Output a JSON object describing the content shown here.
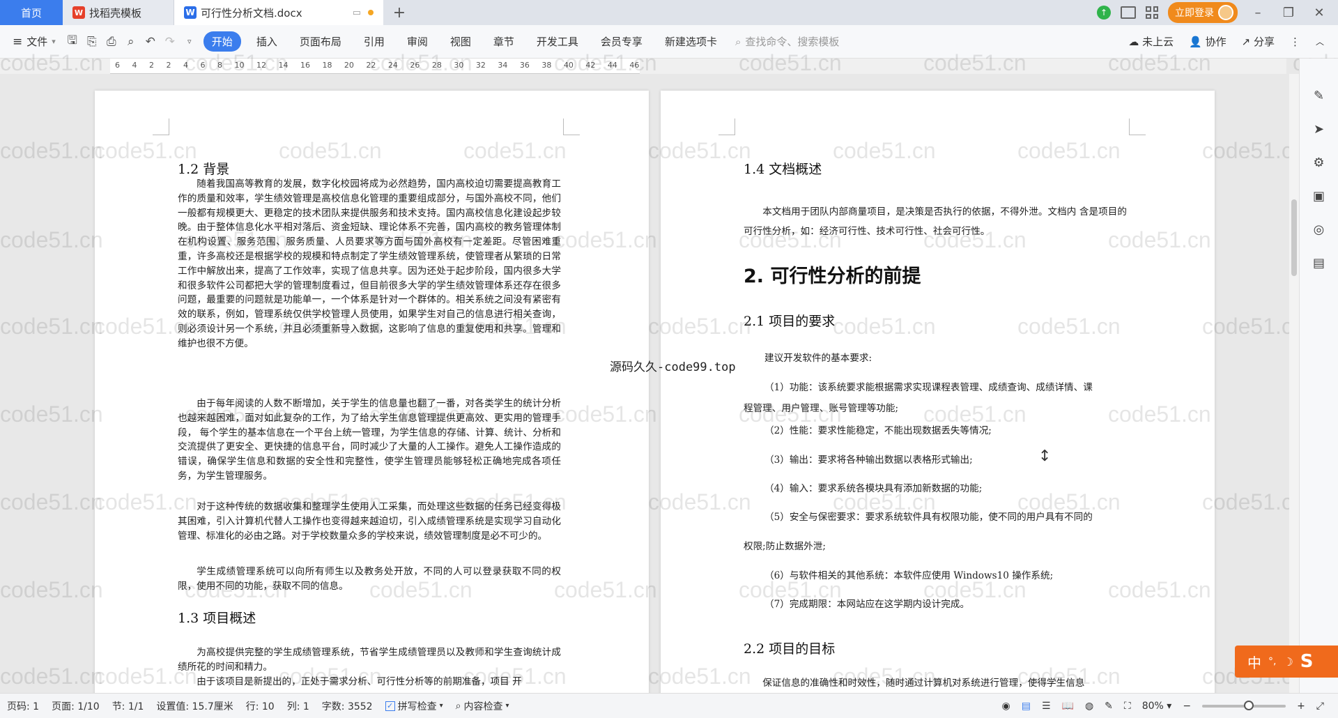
{
  "tabs": {
    "home": "首页",
    "template": "找稻壳模板",
    "document": "可行性分析文档.docx",
    "add": "+"
  },
  "titlebar": {
    "login": "立即登录"
  },
  "toolbar": {
    "file": "文件",
    "menus": [
      "开始",
      "插入",
      "页面布局",
      "引用",
      "审阅",
      "视图",
      "章节",
      "开发工具",
      "会员专享",
      "新建选项卡"
    ],
    "search_placeholder": "查找命令、搜索模板",
    "cloud": "未上云",
    "collab": "协作",
    "share": "分享"
  },
  "ruler_ticks": "6 4 2 2 4 6 8 10 12 14 16 18 20 22 24 26 28 30 32 34 36 38 40 42 44 46",
  "left_page": {
    "h_background": "1.2  背景",
    "p1": "随着我国高等教育的发展，数字化校园将成为必然趋势，国内高校迫切需要提高教育工作的质量和效率，学生绩效管理是高校信息化管理的重要组成部分，与国外高校不同，他们一般都有规模更大、更稳定的技术团队来提供服务和技术支持。国内高校信息化建设起步较晚。由于整体信息化水平相对落后、资金短缺、理论体系不完善，国内高校的教务管理体制在机构设置、服务范围、服务质量、人员要求等方面与国外高校有一定差距。尽管困难重重，许多高校还是根据学校的规模和特点制定了学生绩效管理系统，使管理者从繁琐的日常工作中解放出来，提高了工作效率，实现了信息共享。因为还处于起步阶段，国内很多大学和很多软件公司都把大学的管理制度看过，但目前很多大学的学生绩效管理体系还存在很多问题，最重要的问题就是功能单一，一个体系是针对一个群体的。相关系统之间没有紧密有效的联系，例如，管理系统仅供学校管理人员使用，如果学生对自己的信息进行相关查询，则必须设计另一个系统，并且必须重新导入数据，这影响了信息的重复使用和共享。管理和维护也很不方便。",
    "p2": "由于每年阅读的人数不断增加，关于学生的信息量也翻了一番，对各类学生的统计分析也越来越困难，面对如此复杂的工作，为了给大学生信息管理提供更高效、更实用的管理手段， 每个学生的基本信息在一个平台上统一管理，为学生信息的存储、计算、统计、分析和交流提供了更安全、更快捷的信息平台，同时减少了大量的人工操作。避免人工操作造成的错误，确保学生信息和数据的安全性和完整性，使学生管理员能够轻松正确地完成各项任务，为学生管理服务。",
    "p3": "对于这种传统的数据收集和整理学生使用人工采集，而处理这些数据的任务已经变得极其困难，引入计算机代替人工操作也变得越来越迫切，引入成绩管理系统是实现学习自动化管理、标准化的必由之路。对于学校数量众多的学校来说，绩效管理制度是必不可少的。",
    "p4": "学生成绩管理系统可以向所有师生以及教务处开放，不同的人可以登录获取不同的权限，使用不同的功能，获取不同的信息。",
    "h_overview": "1.3  项目概述",
    "p5": "为高校提供完整的学生成绩管理系统，节省学生成绩管理员以及教师和学生查询统计成绩所花的时间和精力。",
    "p6": "由于该项目是新提出的，正处于需求分析、可行性分析等的前期准备，项目 开"
  },
  "right_page": {
    "h_doc": "1.4  文档概述",
    "p_doc": "本文档用于团队内部商量项目，是决策是否执行的依据，不得外泄。文档内 含是项目的可行性分析，如：经济可行性、技术可行性、社会可行性。",
    "h1": "2.  可行性分析的前提",
    "h_req": "2.1  项目的要求",
    "req_intro": "建议开发软件的基本要求:",
    "req_items": [
      "（1）功能：该系统要求能根据需求实现课程表管理、成绩查询、成绩详情、课",
      "程管理、用户管理、账号管理等功能;",
      "（2）性能：要求性能稳定，不能出现数据丢失等情况;",
      "（3）输出：要求将各种输出数据以表格形式输出;",
      "（4）输入：要求系统各模块具有添加新数据的功能;",
      "（5）安全与保密要求：要求系统软件具有权限功能，使不同的用户具有不同的",
      "权限;防止数据外泄;",
      "（6）与软件相关的其他系统：本软件应使用 Windows10 操作系统;",
      "（7）完成期限：本网站应在这学期内设计完成。"
    ],
    "h_goal": "2.2  项目的目标",
    "p_goal": "保证信息的准确性和时效性，随时通过计算机对系统进行管理，使得学生信息"
  },
  "overlay_text": "源码久久-code99.top",
  "watermark": "code51.cn",
  "ime": "中",
  "status": {
    "page_code": "页码: 1",
    "page": "页面: 1/10",
    "section": "节: 1/1",
    "setting": "设置值: 15.7厘米",
    "row": "行: 10",
    "col": "列: 1",
    "words": "字数: 3552",
    "spell": "拼写检查",
    "content_check": "内容检查",
    "zoom": "80%"
  },
  "colors": {
    "accent": "#3b7ded",
    "login": "#f08a1c",
    "ime": "#f06a1c"
  }
}
